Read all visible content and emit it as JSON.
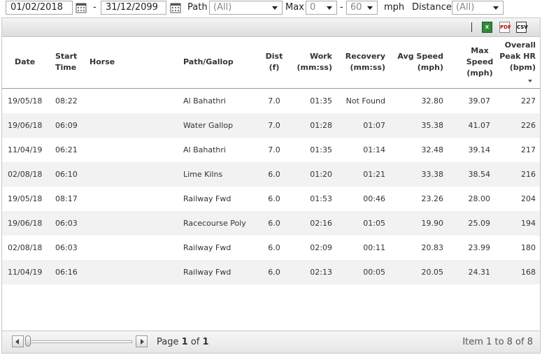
{
  "filters": {
    "date_from": "01/02/2018",
    "dash1": "-",
    "date_to": "31/12/2099",
    "path_label": "Path",
    "path_value": "(All)",
    "max_label": "Max",
    "speed_min": "0",
    "dash2": "-",
    "speed_max": "60",
    "unit": "mph",
    "distance_label": "Distance",
    "distance_value": "(All)"
  },
  "toolbar": {
    "excel_icon": "excel-export-icon",
    "pdf_icon": "pdf-export-icon",
    "csv_icon": "csv-export-icon",
    "excel_text": "X",
    "pdf_text": "PDF",
    "csv_text": "CSV"
  },
  "columns": {
    "date": "Date",
    "start_time": "Start\nTime",
    "horse": "Horse",
    "path": "Path/Gallop",
    "dist": "Dist\n(f)",
    "work": "Work\n(mm:ss)",
    "recovery": "Recovery\n(mm:ss)",
    "avg_speed": "Avg Speed\n(mph)",
    "max_speed": "Max\nSpeed\n(mph)",
    "peak_hr": "Overall\nPeak HR\n(bpm)"
  },
  "rows": [
    {
      "date": "19/05/18",
      "time": "08:22",
      "horse": "",
      "path": "Al Bahathri",
      "dist": "7.0",
      "work": "01:35",
      "recovery": "Not Found",
      "avg": "32.80",
      "max": "39.07",
      "hr": "227"
    },
    {
      "date": "19/06/18",
      "time": "06:09",
      "horse": "",
      "path": "Water Gallop",
      "dist": "7.0",
      "work": "01:28",
      "recovery": "01:07",
      "avg": "35.38",
      "max": "41.07",
      "hr": "226"
    },
    {
      "date": "11/04/19",
      "time": "06:21",
      "horse": "",
      "path": "Al Bahathri",
      "dist": "7.0",
      "work": "01:35",
      "recovery": "01:14",
      "avg": "32.48",
      "max": "39.14",
      "hr": "217"
    },
    {
      "date": "02/08/18",
      "time": "06:10",
      "horse": "",
      "path": "Lime Kilns",
      "dist": "6.0",
      "work": "01:20",
      "recovery": "01:21",
      "avg": "33.38",
      "max": "38.54",
      "hr": "216"
    },
    {
      "date": "19/05/18",
      "time": "08:17",
      "horse": "",
      "path": "Railway Fwd",
      "dist": "6.0",
      "work": "01:53",
      "recovery": "00:46",
      "avg": "23.26",
      "max": "28.00",
      "hr": "204"
    },
    {
      "date": "19/06/18",
      "time": "06:03",
      "horse": "",
      "path": "Racecourse Poly",
      "dist": "6.0",
      "work": "02:16",
      "recovery": "01:05",
      "avg": "19.90",
      "max": "25.09",
      "hr": "194"
    },
    {
      "date": "02/08/18",
      "time": "06:03",
      "horse": "",
      "path": "Railway Fwd",
      "dist": "6.0",
      "work": "02:09",
      "recovery": "00:11",
      "avg": "20.83",
      "max": "23.99",
      "hr": "180"
    },
    {
      "date": "11/04/19",
      "time": "06:16",
      "horse": "",
      "path": "Railway Fwd",
      "dist": "6.0",
      "work": "02:13",
      "recovery": "00:05",
      "avg": "20.05",
      "max": "24.31",
      "hr": "168"
    }
  ],
  "pager": {
    "page_word": "Page",
    "page_current": "1",
    "of_word": "of",
    "page_total": "1",
    "item_text": "Item 1 to 8 of 8"
  }
}
